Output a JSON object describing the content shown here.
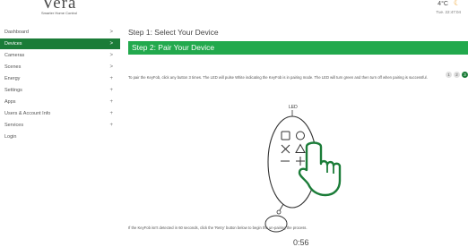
{
  "header": {
    "logo_text": "Vera",
    "logo_sub": "Smarter Home Control",
    "temperature": "4°C",
    "time_label": "Tue.   22:47:04"
  },
  "sidebar": {
    "items": [
      {
        "label": "Dashboard",
        "indicator": ">"
      },
      {
        "label": "Devices",
        "indicator": ">"
      },
      {
        "label": "Cameras",
        "indicator": ">"
      },
      {
        "label": "Scenes",
        "indicator": ">"
      },
      {
        "label": "Energy",
        "indicator": "+"
      },
      {
        "label": "Settings",
        "indicator": "+"
      },
      {
        "label": "Apps",
        "indicator": "+"
      },
      {
        "label": "Users & Account Info",
        "indicator": "+"
      },
      {
        "label": "Services",
        "indicator": "+"
      },
      {
        "label": "Login",
        "indicator": ""
      }
    ]
  },
  "main": {
    "step1_title": "Step 1: Select Your Device",
    "step2_title": "Step 2: Pair Your Device",
    "pager": [
      "1",
      "2",
      "3"
    ],
    "instructions": "To pair the KeyFob, click any button 3 times. The LED will pulse White indicating the KeyFob is in pairing mode. The LED will turn green and then turn off when pairing is successful.",
    "led_label": "LED",
    "retry_text": "If the KeyFob isn't detected in 60 seconds, click the 'Retry' button below to begin the un-pairing the process.",
    "timer": "0:56"
  },
  "colors": {
    "accent_green": "#22a94d",
    "active_green": "#1b7c38"
  }
}
